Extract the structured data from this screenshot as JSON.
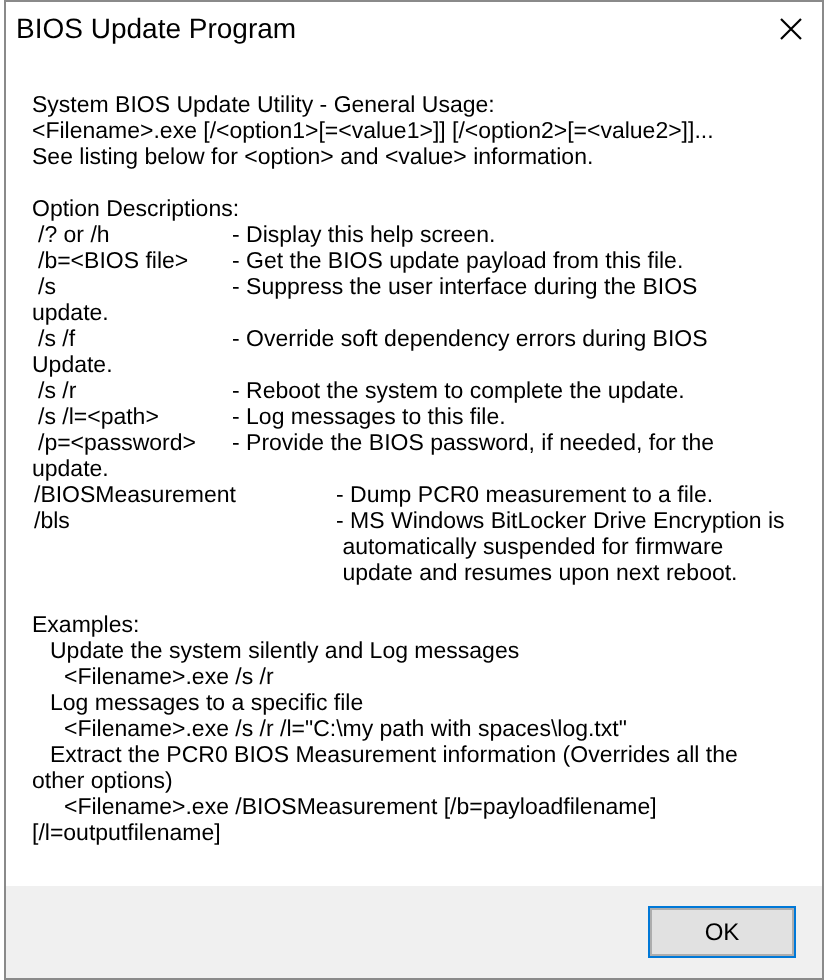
{
  "window": {
    "title": "BIOS Update Program"
  },
  "lines": [
    {
      "kind": "text",
      "text": "System BIOS Update Utility - General Usage:"
    },
    {
      "kind": "text",
      "text": "<Filename>.exe [/<option1>[=<value1>]] [/<option2>[=<value2>]]..."
    },
    {
      "kind": "text",
      "text": "See listing below for <option> and <value> information."
    },
    {
      "kind": "blank"
    },
    {
      "kind": "text",
      "text": "Option Descriptions:"
    },
    {
      "kind": "option",
      "option": "/? or /h",
      "description": [
        "- Display this help screen."
      ]
    },
    {
      "kind": "option",
      "option": "/b=<BIOS file>",
      "description": [
        "- Get the BIOS update payload from this file."
      ]
    },
    {
      "kind": "option",
      "option": "/s",
      "description": [
        "- Suppress the user interface during the BIOS"
      ]
    },
    {
      "kind": "text",
      "text": "update."
    },
    {
      "kind": "option",
      "option": "/s /f",
      "description": [
        "- Override soft dependency errors during BIOS"
      ]
    },
    {
      "kind": "text",
      "text": "Update."
    },
    {
      "kind": "option",
      "option": "/s /r",
      "description": [
        "- Reboot the system to complete the update."
      ]
    },
    {
      "kind": "option",
      "option": "/s /l=<path>",
      "description": [
        "- Log messages to this file."
      ]
    },
    {
      "kind": "option",
      "option": "/p=<password>",
      "description": [
        "- Provide the BIOS password, if needed, for the"
      ]
    },
    {
      "kind": "text",
      "text": "update."
    },
    {
      "kind": "option_wide",
      "option": "/BIOSMeasurement",
      "description": [
        "- Dump PCR0 measurement to a file."
      ]
    },
    {
      "kind": "option_wide",
      "option": "/bls",
      "description": [
        "- MS Windows BitLocker Drive Encryption is",
        " automatically suspended for firmware",
        " update and resumes upon next reboot."
      ]
    },
    {
      "kind": "blank"
    },
    {
      "kind": "text",
      "text": "Examples:"
    },
    {
      "kind": "example",
      "text": "Update the system silently and Log messages"
    },
    {
      "kind": "command",
      "text": "<Filename>.exe /s /r"
    },
    {
      "kind": "example",
      "text": "Log messages to a specific file"
    },
    {
      "kind": "command",
      "text": "<Filename>.exe /s /r /l=\"C:\\my path with spaces\\log.txt\""
    },
    {
      "kind": "example",
      "text": "Extract the PCR0 BIOS Measurement information (Overrides all the"
    },
    {
      "kind": "text",
      "text": "other options)"
    },
    {
      "kind": "command",
      "text": "<Filename>.exe /BIOSMeasurement [/b=payloadfilename]"
    },
    {
      "kind": "text",
      "text": "[/l=outputfilename]"
    }
  ],
  "buttons": [
    {
      "label": "OK"
    }
  ]
}
